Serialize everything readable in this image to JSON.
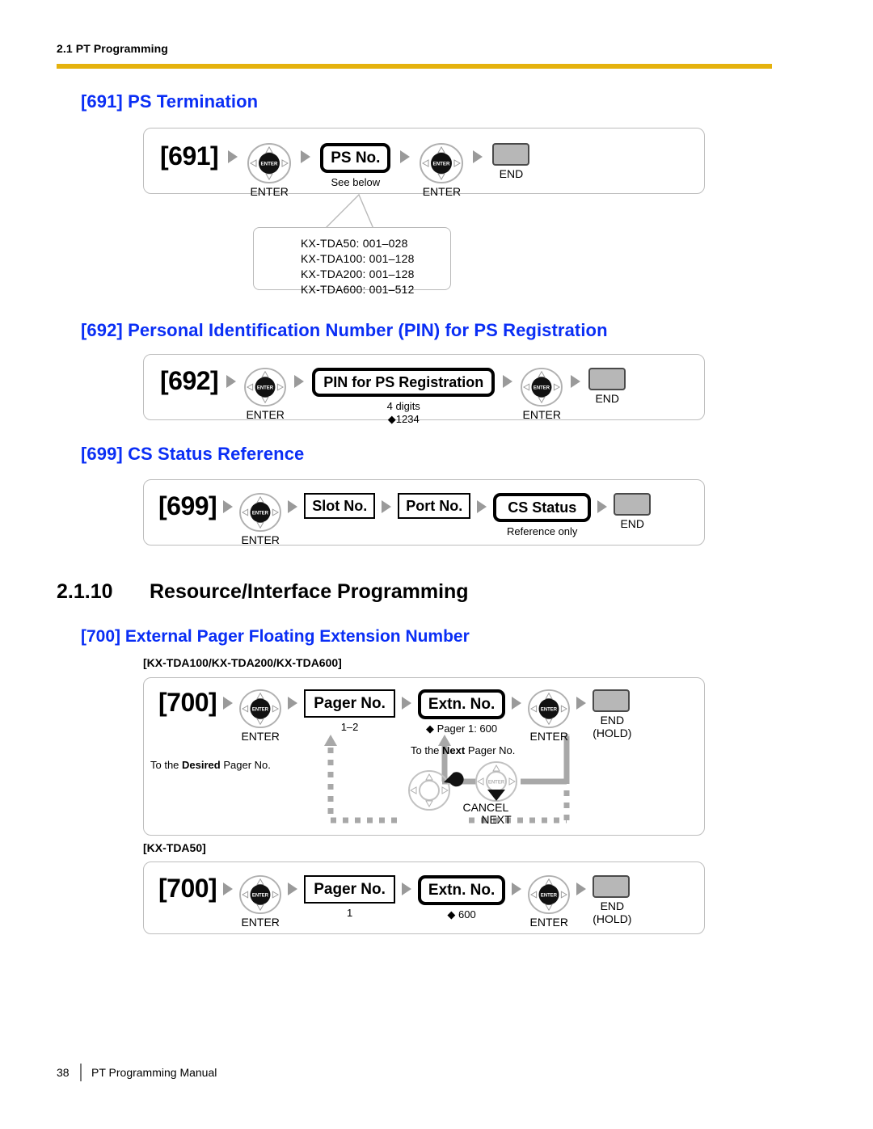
{
  "header": {
    "running_head": "2.1 PT Programming",
    "rule_color": "#e5b20d"
  },
  "colors": {
    "heading_blue": "#0a2ef5",
    "arrow_gray": "#9a9a9a",
    "end_key_fill": "#b7b7b7",
    "loop_gray": "#a8a8a8"
  },
  "sections": {
    "s691": {
      "heading": "[691] PS Termination",
      "code": "[691]",
      "enter1_caption": "ENTER",
      "field_label": "PS No.",
      "field_sub": "See below",
      "enter2_caption": "ENTER",
      "end_caption": "END",
      "callout_lines": [
        "KX-TDA50: 001–028",
        "KX-TDA100: 001–128",
        "KX-TDA200: 001–128",
        "KX-TDA600: 001–512"
      ]
    },
    "s692": {
      "heading": "[692] Personal Identification Number (PIN) for PS Registration",
      "code": "[692]",
      "enter1_caption": "ENTER",
      "field_label": "PIN for PS Registration",
      "field_sub_line1": "4 digits",
      "field_sub_line2": "◆1234",
      "enter2_caption": "ENTER",
      "end_caption": "END"
    },
    "s699": {
      "heading": "[699] CS Status Reference",
      "code": "[699]",
      "enter1_caption": "ENTER",
      "field_slot": "Slot No.",
      "field_port": "Port No.",
      "field_status": "CS Status",
      "field_status_sub": "Reference only",
      "end_caption": "END"
    },
    "chapter": {
      "number": "2.1.10",
      "title": "Resource/Interface Programming"
    },
    "s700": {
      "heading": "[700] External Pager Floating Extension Number",
      "model_tag_a": "[KX-TDA100/KX-TDA200/KX-TDA600]",
      "model_tag_b": "[KX-TDA50]",
      "variant_a": {
        "code": "[700]",
        "enter1_caption": "ENTER",
        "field_pager": "Pager No.",
        "field_pager_sub": "1–2",
        "field_extn": "Extn. No.",
        "field_extn_sub": "◆ Pager 1: 600",
        "enter2_caption": "ENTER",
        "end_caption_line1": "END",
        "end_caption_line2": "(HOLD)",
        "loop_desired_label_pre": "To the ",
        "loop_desired_label_bold": "Desired",
        "loop_desired_label_post": " Pager No.",
        "loop_next_label_pre": "To the ",
        "loop_next_label_bold": "Next",
        "loop_next_label_post": " Pager No.",
        "cancel_caption": "CANCEL",
        "next_caption": "NEXT"
      },
      "variant_b": {
        "code": "[700]",
        "enter1_caption": "ENTER",
        "field_pager": "Pager No.",
        "field_pager_sub": "1",
        "field_extn": "Extn. No.",
        "field_extn_sub": "◆ 600",
        "enter2_caption": "ENTER",
        "end_caption_line1": "END",
        "end_caption_line2": "(HOLD)"
      }
    }
  },
  "footer": {
    "page_number": "38",
    "manual_title": "PT Programming Manual"
  }
}
